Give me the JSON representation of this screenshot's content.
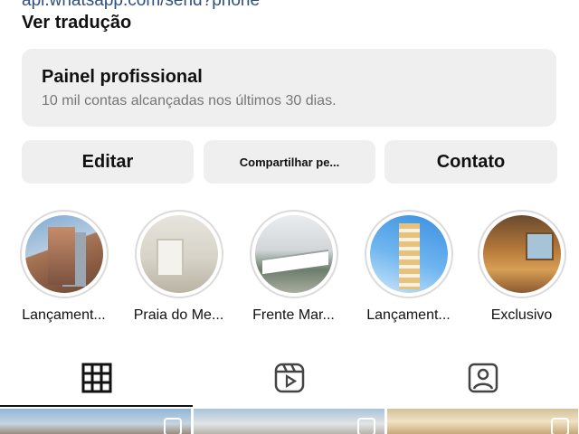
{
  "header": {
    "link_text": "api.whatsapp.com/send?phone",
    "translate_label": "Ver tradução"
  },
  "panel": {
    "title": "Painel profissional",
    "subtitle": "10 mil contas alcançadas nos últimos 30 dias."
  },
  "actions": {
    "edit_label": "Editar",
    "share_label": "Compartilhar pe...",
    "contact_label": "Contato"
  },
  "highlights": [
    {
      "label": "Lançament..."
    },
    {
      "label": "Praia do Me..."
    },
    {
      "label": "Frente Mar..."
    },
    {
      "label": "Lançament..."
    },
    {
      "label": "Exclusivo"
    }
  ],
  "tabs": {
    "icons": [
      "grid-icon",
      "reels-icon",
      "tagged-icon"
    ],
    "active": "grid-icon"
  },
  "posts": {
    "icons": [
      "reels-badge-icon",
      "carousel-badge-icon",
      "carousel-badge-icon"
    ]
  },
  "colors": {
    "surface": "#efefef",
    "text": "#111111",
    "muted": "#777777",
    "link": "#2f4f7a",
    "ring": "#dbdbdb"
  }
}
